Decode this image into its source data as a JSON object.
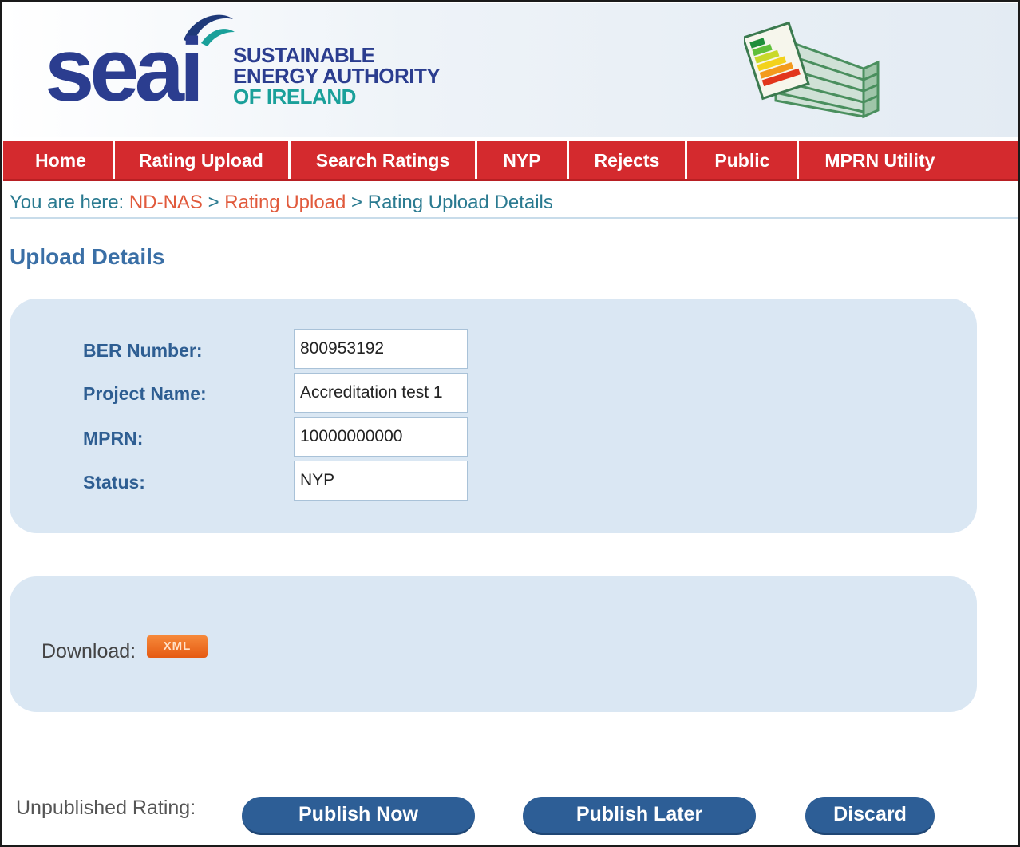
{
  "header": {
    "logo_word": "seai",
    "logo_lines": [
      "SUSTAINABLE",
      "ENERGY AUTHORITY",
      "OF IRELAND"
    ]
  },
  "nav": {
    "items": [
      {
        "label": "Home"
      },
      {
        "label": "Rating Upload"
      },
      {
        "label": "Search Ratings"
      },
      {
        "label": "NYP"
      },
      {
        "label": "Rejects"
      },
      {
        "label": "Public"
      },
      {
        "label": "MPRN Utility"
      }
    ]
  },
  "breadcrumb": {
    "prefix": "You are here: ",
    "crumbs": [
      "ND-NAS",
      "Rating Upload",
      "Rating Upload Details"
    ],
    "separator": " > "
  },
  "page": {
    "title": "Upload Details"
  },
  "details": {
    "fields": [
      {
        "label": "BER Number:",
        "value": "800953192"
      },
      {
        "label": "Project Name:",
        "value": "Accreditation test 1"
      },
      {
        "label": "MPRN:",
        "value": "10000000000"
      },
      {
        "label": "Status:",
        "value": "NYP"
      }
    ]
  },
  "download": {
    "label": "Download:",
    "xml_label": "XML"
  },
  "actions": {
    "label": "Unpublished Rating:",
    "publish_now": "Publish Now",
    "publish_later": "Publish Later",
    "discard": "Discard"
  },
  "colors": {
    "nav_red": "#d42a2e",
    "brand_blue": "#2b3d8f",
    "brand_teal": "#1aa09a",
    "panel_blue": "#dae7f3",
    "button_blue": "#2d5e96",
    "link_orange": "#e15a3c"
  }
}
